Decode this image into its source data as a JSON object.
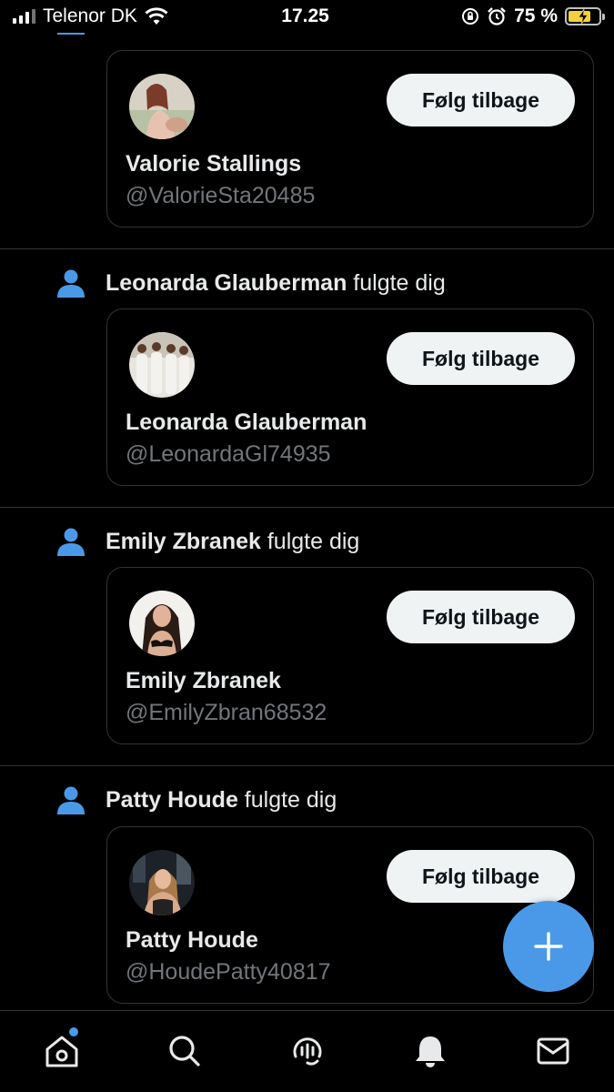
{
  "status_bar": {
    "carrier": "Telenor DK",
    "time": "17.25",
    "battery_text": "75 %",
    "battery_level": 0.75
  },
  "notifications": [
    {
      "actor": "",
      "action": "",
      "card": {
        "name": "Valorie Stallings",
        "handle": "@ValorieSta20485",
        "button": "Følg tilbage"
      }
    },
    {
      "actor": "Leonarda Glauberman",
      "action": " fulgte dig",
      "card": {
        "name": "Leonarda Glauberman",
        "handle": "@LeonardaGl74935",
        "button": "Følg tilbage"
      }
    },
    {
      "actor": "Emily Zbranek",
      "action": " fulgte dig",
      "card": {
        "name": "Emily Zbranek",
        "handle": "@EmilyZbran68532",
        "button": "Følg tilbage"
      }
    },
    {
      "actor": "Patty Houde",
      "action": " fulgte dig",
      "card": {
        "name": "Patty Houde",
        "handle": "@HoudePatty40817",
        "button": "Følg tilbage"
      }
    }
  ],
  "fab": {
    "icon": "plus-icon"
  },
  "tabs": [
    {
      "icon": "home-icon",
      "has_dot": true
    },
    {
      "icon": "search-icon"
    },
    {
      "icon": "spaces-icon"
    },
    {
      "icon": "bell-icon"
    },
    {
      "icon": "mail-icon"
    }
  ],
  "colors": {
    "background": "#000000",
    "accent": "#4a99e9",
    "text": "#e7e9ea",
    "secondary_text": "#71767b",
    "divider": "#2f3336",
    "button_bg": "#eff3f4"
  }
}
